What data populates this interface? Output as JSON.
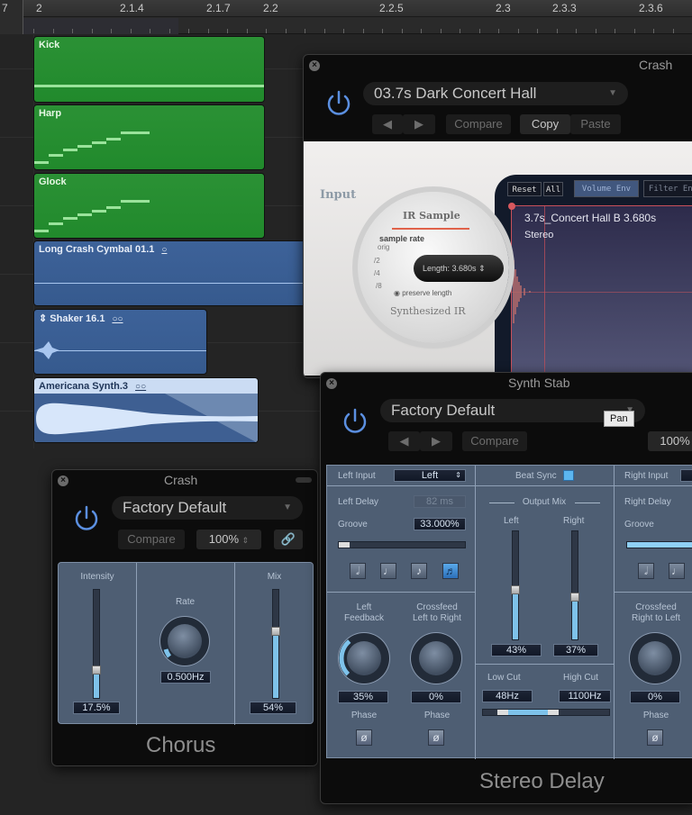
{
  "ruler": {
    "left_fragment": "7",
    "labels": [
      "2",
      "2.1.4",
      "2.1.7",
      "2.2",
      "2.2.5",
      "2.3",
      "2.3.3",
      "2.3.6"
    ]
  },
  "tracks": {
    "regions": [
      {
        "name": "Kick",
        "type": "midi"
      },
      {
        "name": "Harp",
        "type": "midi"
      },
      {
        "name": "Glock",
        "type": "midi"
      },
      {
        "name": "Long Crash Cymbal 01.1",
        "type": "audio",
        "loop_icon": "○"
      },
      {
        "name": "Shaker 16.1",
        "type": "audio",
        "prefix": "⇕",
        "loop_icon": "○○"
      },
      {
        "name": "Americana Synth.3",
        "type": "audio",
        "selected": true,
        "loop_icon": "○○"
      }
    ]
  },
  "space_designer": {
    "title": "Crash",
    "preset": "03.7s Dark Concert Hall",
    "buttons": {
      "prev": "◀",
      "next": "▶",
      "compare": "Compare",
      "copy": "Copy",
      "paste": "Paste"
    },
    "input_label": "Input",
    "ir_sample": "IR Sample",
    "sample_rate_label": "sample rate",
    "sample_rate_options": [
      "orig",
      "/2",
      "/4",
      "/8"
    ],
    "length": "Length:  3.680s",
    "preserve_length": "preserve length",
    "synthesized_ir": "Synthesized IR",
    "env_buttons": {
      "reset": "Reset",
      "all": "All",
      "volume_env": "Volume Env",
      "filter_env": "Filter Env"
    },
    "ir_name": "3.7s_Concert Hall B 3.680s",
    "ir_channels": "Stereo"
  },
  "stereo_delay": {
    "title": "Synth Stab",
    "preset": "Factory Default",
    "buttons": {
      "prev": "◀",
      "next": "▶",
      "compare": "Compare"
    },
    "zoom": "100%",
    "tooltip": "Pan",
    "left": {
      "input_label": "Left Input",
      "input_value": "Left",
      "delay_label": "Left Delay",
      "delay_value": "82 ms",
      "groove_label": "Groove",
      "groove_value": "33.000%",
      "notes": [
        "𝅗𝅥",
        "♩",
        "♪",
        "♬"
      ],
      "feedback_label": "Left\nFeedback",
      "feedback_value": "35%",
      "feedback_pct": 35,
      "crossfeed_label": "Crossfeed\nLeft to Right",
      "crossfeed_value": "0%",
      "phase_label": "Phase",
      "phase_symbol": "ø"
    },
    "center": {
      "beat_sync_label": "Beat Sync",
      "beat_sync_on": true,
      "output_mix_label": "Output Mix",
      "left_label": "Left",
      "right_label": "Right",
      "left_value": "43%",
      "left_pct": 43,
      "right_value": "37%",
      "right_pct": 37,
      "low_cut_label": "Low Cut",
      "low_cut_value": "48Hz",
      "high_cut_label": "High Cut",
      "high_cut_value": "1100Hz"
    },
    "right": {
      "input_label": "Right Input",
      "delay_label": "Right Delay",
      "groove_label": "Groove",
      "crossfeed_label": "Crossfeed\nRight to Left",
      "crossfeed_value": "0%",
      "phase_label": "Phase",
      "phase_symbol": "ø"
    },
    "plugin_name": "Stereo Delay"
  },
  "chorus": {
    "title": "Crash",
    "preset": "Factory Default",
    "buttons": {
      "compare": "Compare",
      "zoom": "100%",
      "link": "link-icon"
    },
    "intensity_label": "Intensity",
    "intensity_value": "17.5%",
    "intensity_pct": 17.5,
    "rate_label": "Rate",
    "rate_value": "0.500Hz",
    "mix_label": "Mix",
    "mix_value": "54%",
    "mix_pct": 54,
    "plugin_name": "Chorus"
  },
  "colors": {
    "midi_region": "#2b9135",
    "audio_region": "#3d6299",
    "panel": "#4e5e73",
    "slider_fill": "#7ec2ea",
    "power_blue": "#5b8fe0"
  }
}
